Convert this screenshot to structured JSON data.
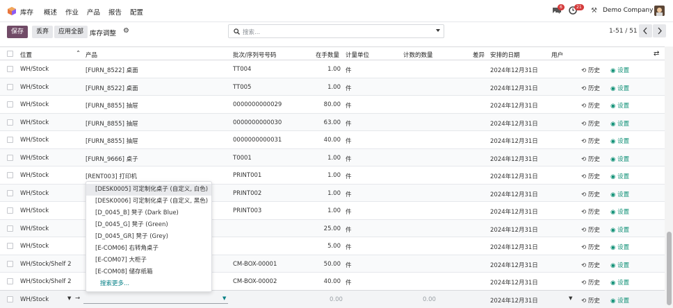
{
  "navbar": {
    "app_name": "库存",
    "menu": [
      "概述",
      "作业",
      "产品",
      "报告",
      "配置"
    ],
    "chat_badge": "6",
    "activity_badge": "21",
    "company": "Demo Company"
  },
  "control_panel": {
    "save_label": "保存",
    "discard_label": "丢弃",
    "apply_all_label": "应用全部",
    "title": "库存调整",
    "search_placeholder": "搜索...",
    "pager": "1-51 / 51"
  },
  "table": {
    "headers": {
      "location": "位置",
      "product": "产品",
      "lot": "批次/序列号号码",
      "on_hand": "在手数量",
      "uom": "计量单位",
      "counted": "计数的数量",
      "diff": "差异",
      "date": "安排的日期",
      "user": "用户"
    },
    "rows": [
      {
        "location": "WH/Stock",
        "product": "[FURN_8522] 桌面",
        "lot": "TT004",
        "qty": "1.00",
        "uom": "件",
        "date": "2024年12月31日"
      },
      {
        "location": "WH/Stock",
        "product": "[FURN_8522] 桌面",
        "lot": "TT005",
        "qty": "1.00",
        "uom": "件",
        "date": "2024年12月31日"
      },
      {
        "location": "WH/Stock",
        "product": "[FURN_8855] 抽屉",
        "lot": "0000000000029",
        "qty": "80.00",
        "uom": "件",
        "date": "2024年12月31日"
      },
      {
        "location": "WH/Stock",
        "product": "[FURN_8855] 抽屉",
        "lot": "0000000000030",
        "qty": "63.00",
        "uom": "件",
        "date": "2024年12月31日"
      },
      {
        "location": "WH/Stock",
        "product": "[FURN_8855] 抽屉",
        "lot": "0000000000031",
        "qty": "40.00",
        "uom": "件",
        "date": "2024年12月31日"
      },
      {
        "location": "WH/Stock",
        "product": "[FURN_9666] 桌子",
        "lot": "T0001",
        "qty": "1.00",
        "uom": "件",
        "date": "2024年12月31日"
      },
      {
        "location": "WH/Stock",
        "product": "[RENT003] 打印机",
        "lot": "PRINT001",
        "qty": "1.00",
        "uom": "件",
        "date": "2024年12月31日"
      },
      {
        "location": "WH/Stock",
        "product": "",
        "lot": "PRINT002",
        "qty": "1.00",
        "uom": "件",
        "date": "2024年12月31日"
      },
      {
        "location": "WH/Stock",
        "product": "",
        "lot": "PRINT003",
        "qty": "1.00",
        "uom": "件",
        "date": "2024年12月31日"
      },
      {
        "location": "WH/Stock",
        "product": "",
        "lot": "",
        "qty": "25.00",
        "uom": "件",
        "date": "2024年12月31日"
      },
      {
        "location": "WH/Stock",
        "product": "",
        "lot": "",
        "qty": "5.00",
        "uom": "件",
        "date": "2024年12月31日"
      },
      {
        "location": "WH/Stock/Shelf 2",
        "product": "",
        "lot": "CM-BOX-00001",
        "qty": "50.00",
        "uom": "件",
        "date": "2024年12月31日"
      },
      {
        "location": "WH/Stock/Shelf 2",
        "product": "",
        "lot": "CM-BOX-00002",
        "qty": "40.00",
        "uom": "件",
        "date": "2024年12月31日"
      }
    ],
    "history_label": "历史",
    "set_label": "设置",
    "edit_row": {
      "location": "WH/Stock",
      "qty": "0.00",
      "counted": "0.00",
      "date": "2024年12月31日"
    }
  },
  "dropdown": {
    "items": [
      "[DESK0005] 可定制化桌子 (自定义, 白色)",
      "[DESK0006] 可定制化桌子 (自定义, 黑色)",
      "[D_0045_B] 凳子 (Dark Blue)",
      "[D_0045_G] 凳子 (Green)",
      "[D_0045_GR] 凳子 (Grey)",
      "[E-COM06] 右转角桌子",
      "[E-COM07] 大柜子",
      "[E-COM08] 储存纸箱"
    ],
    "more": "搜索更多..."
  },
  "colors": {
    "primary": "#714B67",
    "accent_green": "#0c8f74",
    "badge_red": "#d43b3b"
  }
}
